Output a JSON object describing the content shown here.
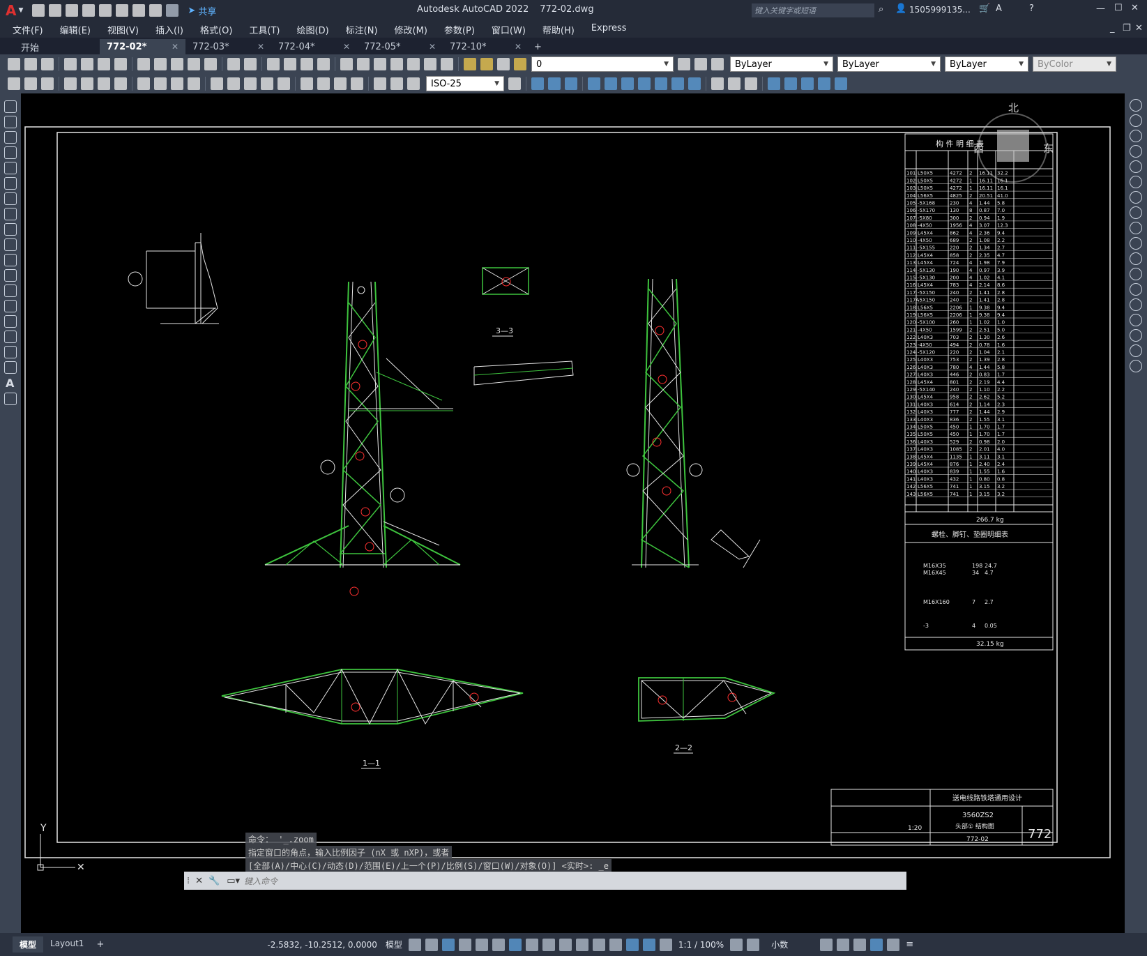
{
  "titlebar": {
    "app_title": "Autodesk AutoCAD 2022",
    "file_name": "772-02.dwg",
    "share_label": "共享",
    "search_placeholder": "键入关键字或短语",
    "user_name": "1505999135..."
  },
  "menu": {
    "items": [
      "文件(F)",
      "编辑(E)",
      "视图(V)",
      "插入(I)",
      "格式(O)",
      "工具(T)",
      "绘图(D)",
      "标注(N)",
      "修改(M)",
      "参数(P)",
      "窗口(W)",
      "帮助(H)",
      "Express"
    ]
  },
  "tabs": [
    {
      "label": "开始",
      "active": false
    },
    {
      "label": "772-02*",
      "active": true
    },
    {
      "label": "772-03*",
      "active": false
    },
    {
      "label": "772-04*",
      "active": false
    },
    {
      "label": "772-05*",
      "active": false
    },
    {
      "label": "772-10*",
      "active": false
    }
  ],
  "properties": {
    "layer_value": "0",
    "color_value": "ByLayer",
    "linetype_value": "ByLayer",
    "lineweight_value": "ByLayer",
    "plotstyle_value": "ByColor",
    "dimstyle_value": "ISO-25"
  },
  "viewcube": {
    "north": "北",
    "west": "西",
    "east": "东"
  },
  "drawing": {
    "section_11": "1—1",
    "section_22": "2—2",
    "section_33": "3—3",
    "table_title": "构  件  明  细  表",
    "total_weight": "266.7 kg",
    "bolt_table_title": "螺栓、脚钉、垫圈明细表",
    "bolt_total": "32.15 kg",
    "bolt_rows": [
      {
        "spec": "M16X35",
        "qty": "198",
        "weight": "24.7"
      },
      {
        "spec": "M16X45",
        "qty": "34",
        "weight": "4.7"
      },
      {
        "spec": "M16X160",
        "qty": "7",
        "weight": "2.7"
      },
      {
        "spec": "-3",
        "qty": "4",
        "weight": "0.05"
      }
    ],
    "parts": [
      {
        "no": "101",
        "spec": "L50X5",
        "len": "4272",
        "qty": "2",
        "w": "16.11",
        "tw": "32.2"
      },
      {
        "no": "102",
        "spec": "L50X5",
        "len": "4272",
        "qty": "1",
        "w": "16.11",
        "tw": "16.1"
      },
      {
        "no": "103",
        "spec": "L50X5",
        "len": "4272",
        "qty": "1",
        "w": "16.11",
        "tw": "16.1"
      },
      {
        "no": "104",
        "spec": "L56X5",
        "len": "4825",
        "qty": "2",
        "w": "20.51",
        "tw": "41.0"
      },
      {
        "no": "105",
        "spec": "-5X168",
        "len": "230",
        "qty": "4",
        "w": "1.44",
        "tw": "5.8"
      },
      {
        "no": "106",
        "spec": "-5X170",
        "len": "130",
        "qty": "8",
        "w": "0.87",
        "tw": "7.0"
      },
      {
        "no": "107",
        "spec": "-5X80",
        "len": "300",
        "qty": "2",
        "w": "0.94",
        "tw": "1.9"
      },
      {
        "no": "108",
        "spec": "-4X50",
        "len": "1956",
        "qty": "4",
        "w": "3.07",
        "tw": "12.3"
      },
      {
        "no": "109",
        "spec": "L45X4",
        "len": "862",
        "qty": "4",
        "w": "2.36",
        "tw": "9.4"
      },
      {
        "no": "110",
        "spec": "-4X50",
        "len": "689",
        "qty": "2",
        "w": "1.08",
        "tw": "2.2"
      },
      {
        "no": "111",
        "spec": "-5X155",
        "len": "220",
        "qty": "2",
        "w": "1.34",
        "tw": "2.7"
      },
      {
        "no": "112",
        "spec": "L45X4",
        "len": "858",
        "qty": "2",
        "w": "2.35",
        "tw": "4.7"
      },
      {
        "no": "113",
        "spec": "L45X4",
        "len": "724",
        "qty": "4",
        "w": "1.98",
        "tw": "7.9"
      },
      {
        "no": "114",
        "spec": "-5X130",
        "len": "190",
        "qty": "4",
        "w": "0.97",
        "tw": "3.9"
      },
      {
        "no": "115",
        "spec": "-5X130",
        "len": "200",
        "qty": "4",
        "w": "1.02",
        "tw": "4.1"
      },
      {
        "no": "116",
        "spec": "L45X4",
        "len": "783",
        "qty": "4",
        "w": "2.14",
        "tw": "8.6"
      },
      {
        "no": "117",
        "spec": "-5X150",
        "len": "240",
        "qty": "2",
        "w": "1.41",
        "tw": "2.8"
      },
      {
        "no": "117A",
        "spec": "-5X150",
        "len": "240",
        "qty": "2",
        "w": "1.41",
        "tw": "2.8"
      },
      {
        "no": "118",
        "spec": "L56X5",
        "len": "2206",
        "qty": "1",
        "w": "9.38",
        "tw": "9.4"
      },
      {
        "no": "119",
        "spec": "L56X5",
        "len": "2206",
        "qty": "1",
        "w": "9.38",
        "tw": "9.4"
      },
      {
        "no": "120",
        "spec": "-5X100",
        "len": "260",
        "qty": "1",
        "w": "1.02",
        "tw": "1.0"
      },
      {
        "no": "121",
        "spec": "-4X50",
        "len": "1599",
        "qty": "2",
        "w": "2.51",
        "tw": "5.0"
      },
      {
        "no": "122",
        "spec": "L40X3",
        "len": "703",
        "qty": "2",
        "w": "1.30",
        "tw": "2.6"
      },
      {
        "no": "123",
        "spec": "-4X50",
        "len": "494",
        "qty": "2",
        "w": "0.78",
        "tw": "1.6"
      },
      {
        "no": "124",
        "spec": "-5X120",
        "len": "220",
        "qty": "2",
        "w": "1.04",
        "tw": "2.1"
      },
      {
        "no": "125",
        "spec": "L40X3",
        "len": "753",
        "qty": "2",
        "w": "1.39",
        "tw": "2.8"
      },
      {
        "no": "126",
        "spec": "L40X3",
        "len": "780",
        "qty": "4",
        "w": "1.44",
        "tw": "5.8"
      },
      {
        "no": "127",
        "spec": "L40X3",
        "len": "446",
        "qty": "2",
        "w": "0.83",
        "tw": "1.7"
      },
      {
        "no": "128",
        "spec": "L45X4",
        "len": "801",
        "qty": "2",
        "w": "2.19",
        "tw": "4.4"
      },
      {
        "no": "129",
        "spec": "-5X140",
        "len": "240",
        "qty": "2",
        "w": "1.10",
        "tw": "2.2"
      },
      {
        "no": "130",
        "spec": "L45X4",
        "len": "958",
        "qty": "2",
        "w": "2.62",
        "tw": "5.2"
      },
      {
        "no": "131",
        "spec": "L40X3",
        "len": "614",
        "qty": "2",
        "w": "1.14",
        "tw": "2.3"
      },
      {
        "no": "132",
        "spec": "L40X3",
        "len": "777",
        "qty": "2",
        "w": "1.44",
        "tw": "2.9"
      },
      {
        "no": "133",
        "spec": "L40X3",
        "len": "836",
        "qty": "2",
        "w": "1.55",
        "tw": "3.1"
      },
      {
        "no": "134",
        "spec": "L50X5",
        "len": "450",
        "qty": "1",
        "w": "1.70",
        "tw": "1.7"
      },
      {
        "no": "135",
        "spec": "L50X5",
        "len": "450",
        "qty": "1",
        "w": "1.70",
        "tw": "1.7"
      },
      {
        "no": "136",
        "spec": "L40X3",
        "len": "529",
        "qty": "2",
        "w": "0.98",
        "tw": "2.0"
      },
      {
        "no": "137",
        "spec": "L40X3",
        "len": "1085",
        "qty": "2",
        "w": "2.01",
        "tw": "4.0"
      },
      {
        "no": "138",
        "spec": "L45X4",
        "len": "1135",
        "qty": "1",
        "w": "3.11",
        "tw": "3.1"
      },
      {
        "no": "139",
        "spec": "L45X4",
        "len": "876",
        "qty": "1",
        "w": "2.40",
        "tw": "2.4"
      },
      {
        "no": "140",
        "spec": "L40X3",
        "len": "839",
        "qty": "1",
        "w": "1.55",
        "tw": "1.6"
      },
      {
        "no": "141",
        "spec": "L40X3",
        "len": "432",
        "qty": "1",
        "w": "0.80",
        "tw": "0.8"
      },
      {
        "no": "142",
        "spec": "L56X5",
        "len": "741",
        "qty": "1",
        "w": "3.15",
        "tw": "3.2"
      },
      {
        "no": "143",
        "spec": "L56X5",
        "len": "741",
        "qty": "1",
        "w": "3.15",
        "tw": "3.2"
      }
    ],
    "title_block": {
      "project": "送电线路铁塔通用设计",
      "tower": "3560ZS2",
      "sheet_title": "头部① 结构图",
      "scale": "1:20",
      "drawing_no": "772-02",
      "big_no": "772"
    }
  },
  "command": {
    "history": [
      "命令： '_.zoom",
      "指定窗口的角点，输入比例因子 (nX 或 nXP)，或者",
      "[全部(A)/中心(C)/动态(D)/范围(E)/上一个(P)/比例(S)/窗口(W)/对象(O)] <实时>: _e"
    ],
    "placeholder": "键入命令"
  },
  "status": {
    "coords": "-2.5832, -10.2512, 0.0000",
    "model_label": "模型",
    "layout_tabs": [
      "模型",
      "Layout1"
    ],
    "scale": "1:1 / 100%",
    "units": "小数"
  }
}
